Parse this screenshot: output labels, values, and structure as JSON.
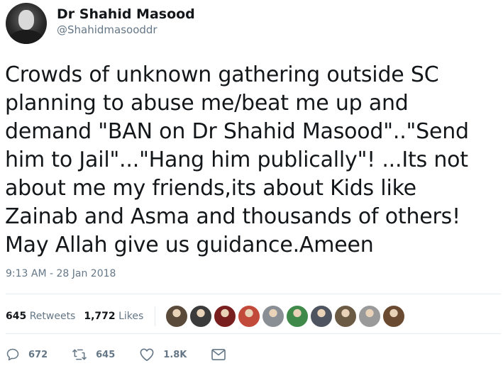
{
  "user": {
    "display_name": "Dr Shahid Masood",
    "handle": "@Shahidmasooddr"
  },
  "tweet": {
    "text": "Crowds of unknown gathering outside SC\nplanning to abuse me/beat me up and\ndemand \"BAN on Dr Shahid Masood\"..\"Send\nhim to Jail\"...\"Hang him publically\"! ...Its not\nabout me my friends,its about Kids like\nZainab and Asma and thousands of others!\nMay Allah give us guidance.Ameen",
    "timestamp": "9:13 AM - 28 Jan 2018"
  },
  "stats": {
    "retweets_count": "645",
    "retweets_label": "Retweets",
    "likes_count": "1,772",
    "likes_label": "Likes"
  },
  "likers": [
    {
      "color": "#5a4a3a"
    },
    {
      "color": "#3b3b3b"
    },
    {
      "color": "#7a1f1f"
    },
    {
      "color": "#c24a3a"
    },
    {
      "color": "#8a8f96"
    },
    {
      "color": "#3f8a4a"
    },
    {
      "color": "#4e5560"
    },
    {
      "color": "#6b5a44"
    },
    {
      "color": "#9a9a9a"
    },
    {
      "color": "#6a4a30"
    }
  ],
  "actions": {
    "reply_count": "672",
    "retweet_count": "645",
    "like_count": "1.8K"
  },
  "colors": {
    "text": "#14171a",
    "secondary": "#657786",
    "divider": "#e6ecf0"
  }
}
